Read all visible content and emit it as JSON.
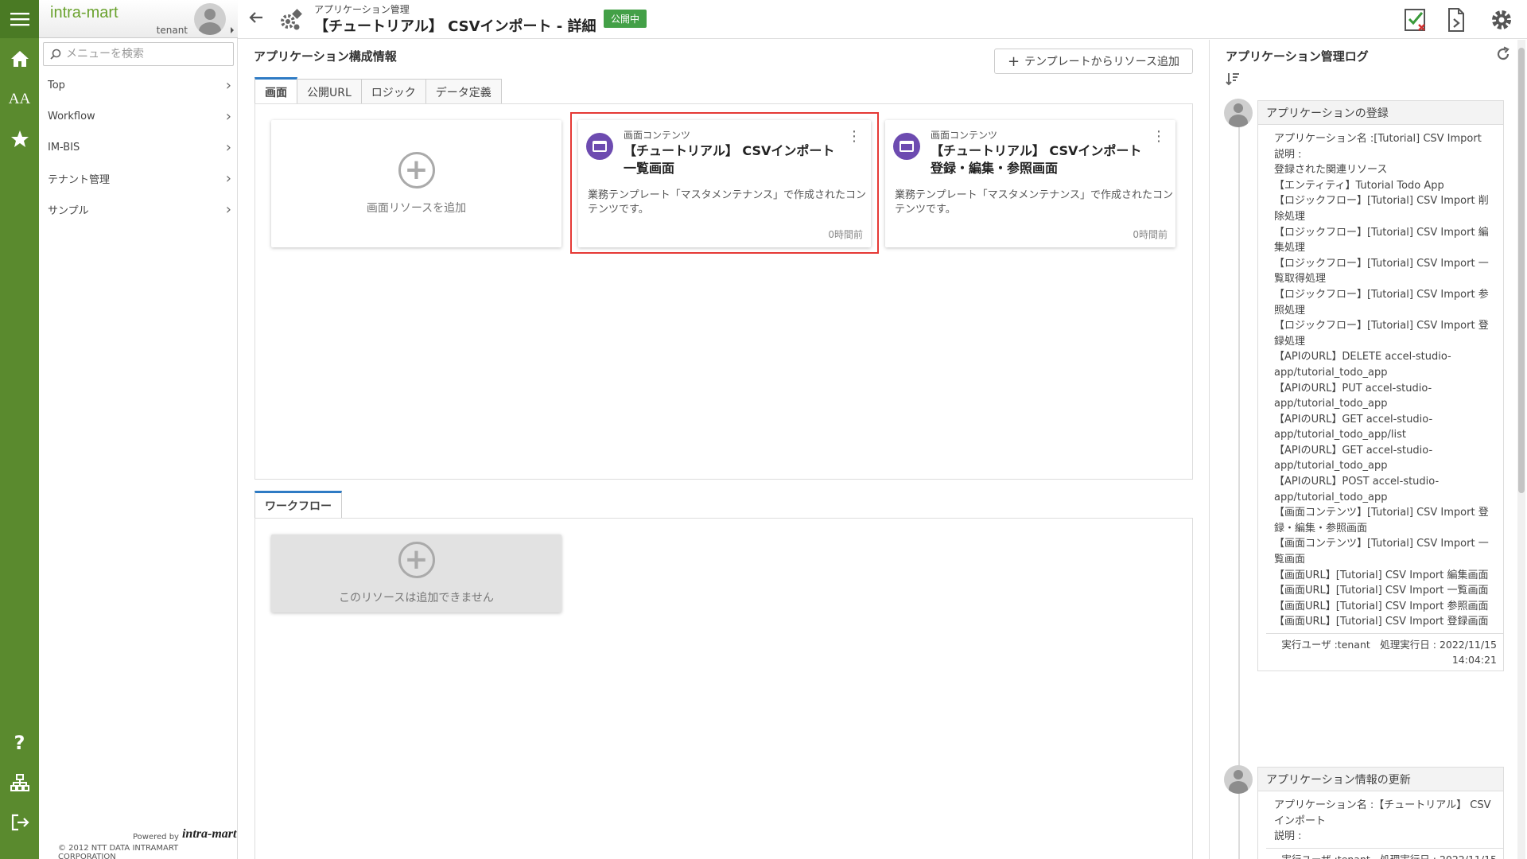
{
  "sidebar": {
    "logo": "intra-mart",
    "tenant": "tenant",
    "search_placeholder": "メニューを検索",
    "items": [
      {
        "label": "Top"
      },
      {
        "label": "Workflow"
      },
      {
        "label": "IM-BIS"
      },
      {
        "label": "テナント管理"
      },
      {
        "label": "サンプル"
      }
    ],
    "powered_by": "Powered by",
    "brand": "intra-mart",
    "copyright": "© 2012 NTT DATA INTRAMART CORPORATION"
  },
  "header": {
    "breadcrumb": "アプリケーション管理",
    "title": "【チュートリアル】 CSVインポート - 詳細",
    "status_badge": "公開中",
    "badge_color": "#43a047"
  },
  "main": {
    "section_title": "アプリケーション構成情報",
    "add_from_template": "テンプレートからリソース追加",
    "tabs": [
      {
        "label": "画面",
        "active": true
      },
      {
        "label": "公開URL"
      },
      {
        "label": "ロジック"
      },
      {
        "label": "データ定義"
      }
    ],
    "add_screen_label": "画面リソースを追加",
    "cards": [
      {
        "type": "画面コンテンツ",
        "name": "【チュートリアル】 CSVインポート 一覧画面",
        "description": "業務テンプレート「マスタメンテナンス」で作成されたコンテンツです。",
        "time": "0時間前"
      },
      {
        "type": "画面コンテンツ",
        "name": "【チュートリアル】 CSVインポート 登録・編集・参照画面",
        "description": "業務テンプレート「マスタメンテナンス」で作成されたコンテンツです。",
        "time": "0時間前"
      }
    ],
    "workflow_tab": "ワークフロー",
    "workflow_card_label": "このリソースは追加できません",
    "highlight_color": "#e53935",
    "accent_color": "#2e7bc4"
  },
  "log": {
    "title": "アプリケーション管理ログ",
    "entries": [
      {
        "heading": "アプリケーションの登録",
        "lines": [
          "アプリケーション名 :[Tutorial] CSV Import",
          "説明 :",
          "登録された関連リソース",
          "【エンティティ】Tutorial Todo App",
          "【ロジックフロー】[Tutorial] CSV Import 削除処理",
          "【ロジックフロー】[Tutorial] CSV Import 編集処理",
          "【ロジックフロー】[Tutorial] CSV Import 一覧取得処理",
          "【ロジックフロー】[Tutorial] CSV Import 参照処理",
          "【ロジックフロー】[Tutorial] CSV Import 登録処理",
          "【APIのURL】DELETE accel-studio-app/tutorial_todo_app",
          "【APIのURL】PUT accel-studio-app/tutorial_todo_app",
          "【APIのURL】GET accel-studio-app/tutorial_todo_app/list",
          "【APIのURL】GET accel-studio-app/tutorial_todo_app",
          "【APIのURL】POST accel-studio-app/tutorial_todo_app",
          "【画面コンテンツ】[Tutorial] CSV Import 登録・編集・参照画面",
          "【画面コンテンツ】[Tutorial] CSV Import 一覧画面",
          "【画面URL】[Tutorial] CSV Import 編集画面",
          "【画面URL】[Tutorial] CSV Import 一覧画面",
          "【画面URL】[Tutorial] CSV Import 参照画面",
          "【画面URL】[Tutorial] CSV Import 登録画面"
        ],
        "footer": "実行ユーザ :tenant　処理実行日 : 2022/11/15 14:04:21"
      },
      {
        "heading": "アプリケーション情報の更新",
        "lines": [
          "アプリケーション名 :【チュートリアル】 CSVインポート",
          "説明 :"
        ],
        "footer": "実行ユーザ :tenant　処理実行日 : 2022/11/15"
      }
    ]
  }
}
